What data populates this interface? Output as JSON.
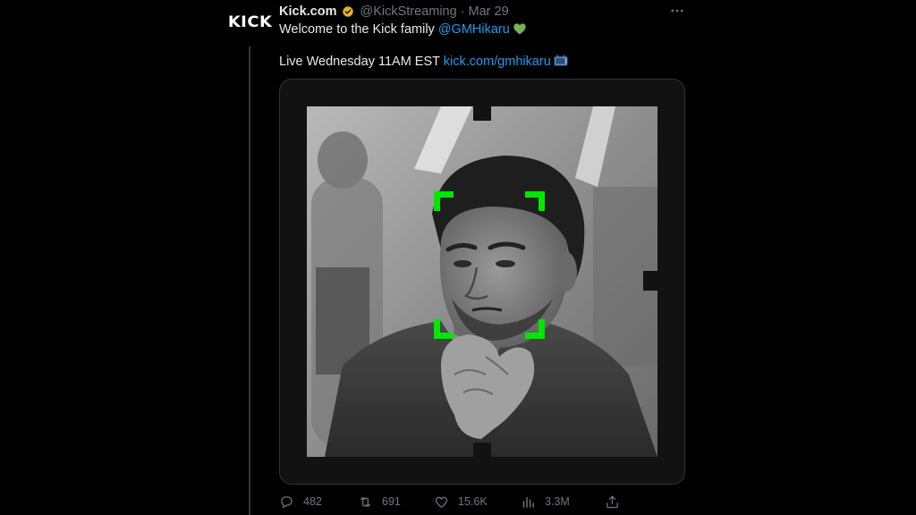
{
  "author": {
    "avatar_text": "KICK",
    "display_name": "Kick.com",
    "handle": "@KickStreaming",
    "separator": "·",
    "date": "Mar 29"
  },
  "tweet": {
    "line1_text": "Welcome to the Kick family ",
    "line1_mention": "@GMHikaru",
    "line2_text": "Live Wednesday 11AM EST ",
    "line2_link": "kick.com/gmhikaru"
  },
  "stats": {
    "replies": "482",
    "retweets": "691",
    "likes": "15.6K",
    "views": "3.3M"
  },
  "icons": {
    "verified": "verified-badge-icon",
    "more": "more-dots-icon",
    "heart_emoji": "green-heart-emoji",
    "tv_emoji": "tv-emoji",
    "reply": "reply-icon",
    "retweet": "retweet-icon",
    "like": "like-icon",
    "views": "views-icon",
    "share": "share-icon"
  },
  "colors": {
    "accent": "#1d9bf0",
    "kick_green": "#00e701",
    "verified_gold": "#e2b719",
    "muted": "#71767b"
  }
}
